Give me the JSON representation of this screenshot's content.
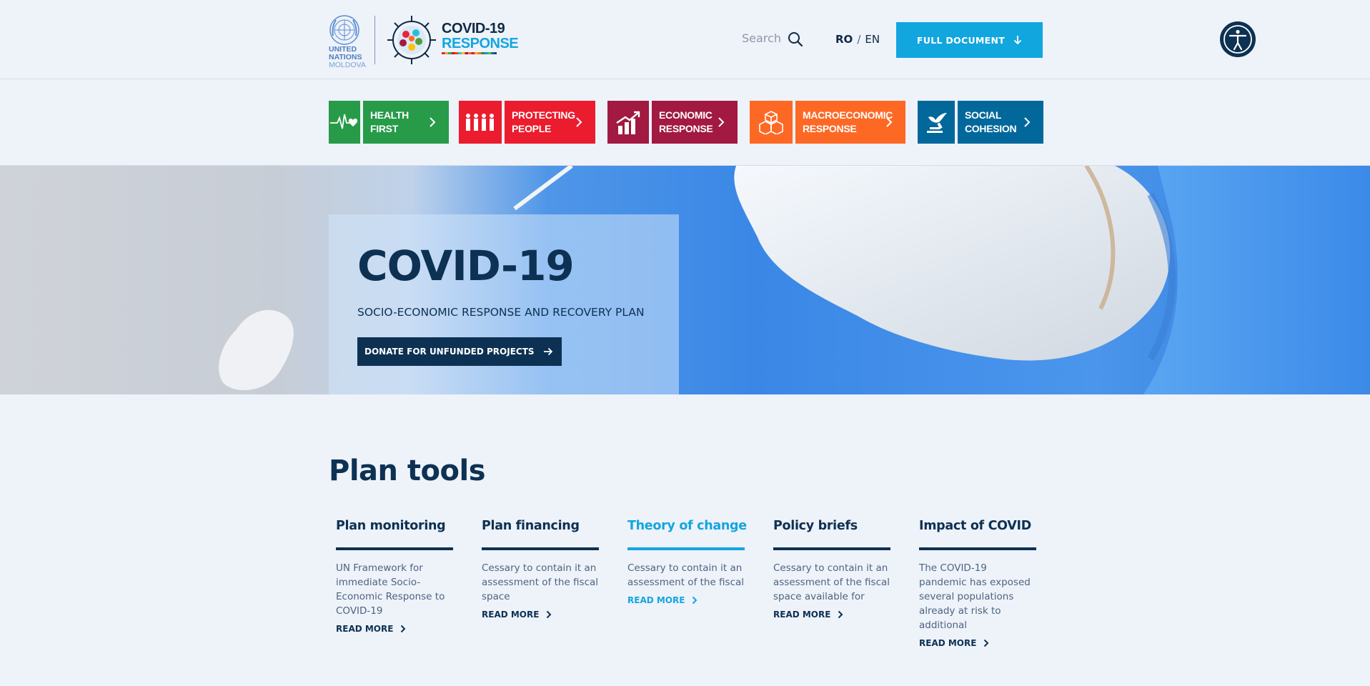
{
  "header": {
    "un_logo_text": "UNITED\nNATIONS",
    "un_logo_country": "MOLDOVA",
    "brand_title": "COVID-19",
    "brand_subtitle": "RESPONSE",
    "search_placeholder": "Search",
    "lang_ro": "RO",
    "lang_sep": "/",
    "lang_en": "EN",
    "full_document_label": "FULL DOCUMENT",
    "icons": [
      "un-emblem-icon",
      "covid-emblem-icon",
      "search-icon",
      "arrow-down-icon",
      "accessibility-icon"
    ]
  },
  "categories": [
    {
      "label": "HEALTH\nFIRST",
      "color": "#279b48",
      "icon": "heartbeat-icon"
    },
    {
      "label": "PROTECTING\nPEOPLE",
      "color": "#eb1c2d",
      "icon": "family-icon"
    },
    {
      "label": "ECONOMIC\nRESPONSE",
      "color": "#a21942",
      "icon": "growth-chart-icon"
    },
    {
      "label": "MACROECONOMIC\nRESPONSE",
      "color": "#fd6925",
      "icon": "cubes-icon"
    },
    {
      "label": "SOCIAL\nCOHESION",
      "color": "#02689b",
      "icon": "dove-gavel-icon"
    }
  ],
  "hero": {
    "title": "COVID-19",
    "subtitle": "SOCIO-ECONOMIC RESPONSE AND RECOVERY PLAN",
    "donate_label": "DONATE FOR UNFUNDED PROJECTS"
  },
  "plan_tools": {
    "title": "Plan tools",
    "items": [
      {
        "title": "Plan monitoring",
        "desc": "UN Framework for immediate Socio-Economic Response to COVID-19",
        "more": "READ MORE",
        "active": false
      },
      {
        "title": "Plan financing",
        "desc": "Cessary to contain it an assessment of the fiscal space",
        "more": "READ MORE",
        "active": false
      },
      {
        "title": "Theory of change",
        "desc": "Cessary to contain it an assessment of the fiscal",
        "more": "READ MORE",
        "active": true
      },
      {
        "title": "Policy briefs",
        "desc": "Cessary to contain it an assessment of the fiscal space available for",
        "more": "READ MORE",
        "active": false
      },
      {
        "title": "Impact of COVID",
        "desc": "The COVID-19 pandemic has exposed several populations already at risk to additional",
        "more": "READ MORE",
        "active": false
      }
    ]
  },
  "colors": {
    "accent": "#12a6df",
    "navy": "#0d3153",
    "background": "#eef2f9"
  }
}
